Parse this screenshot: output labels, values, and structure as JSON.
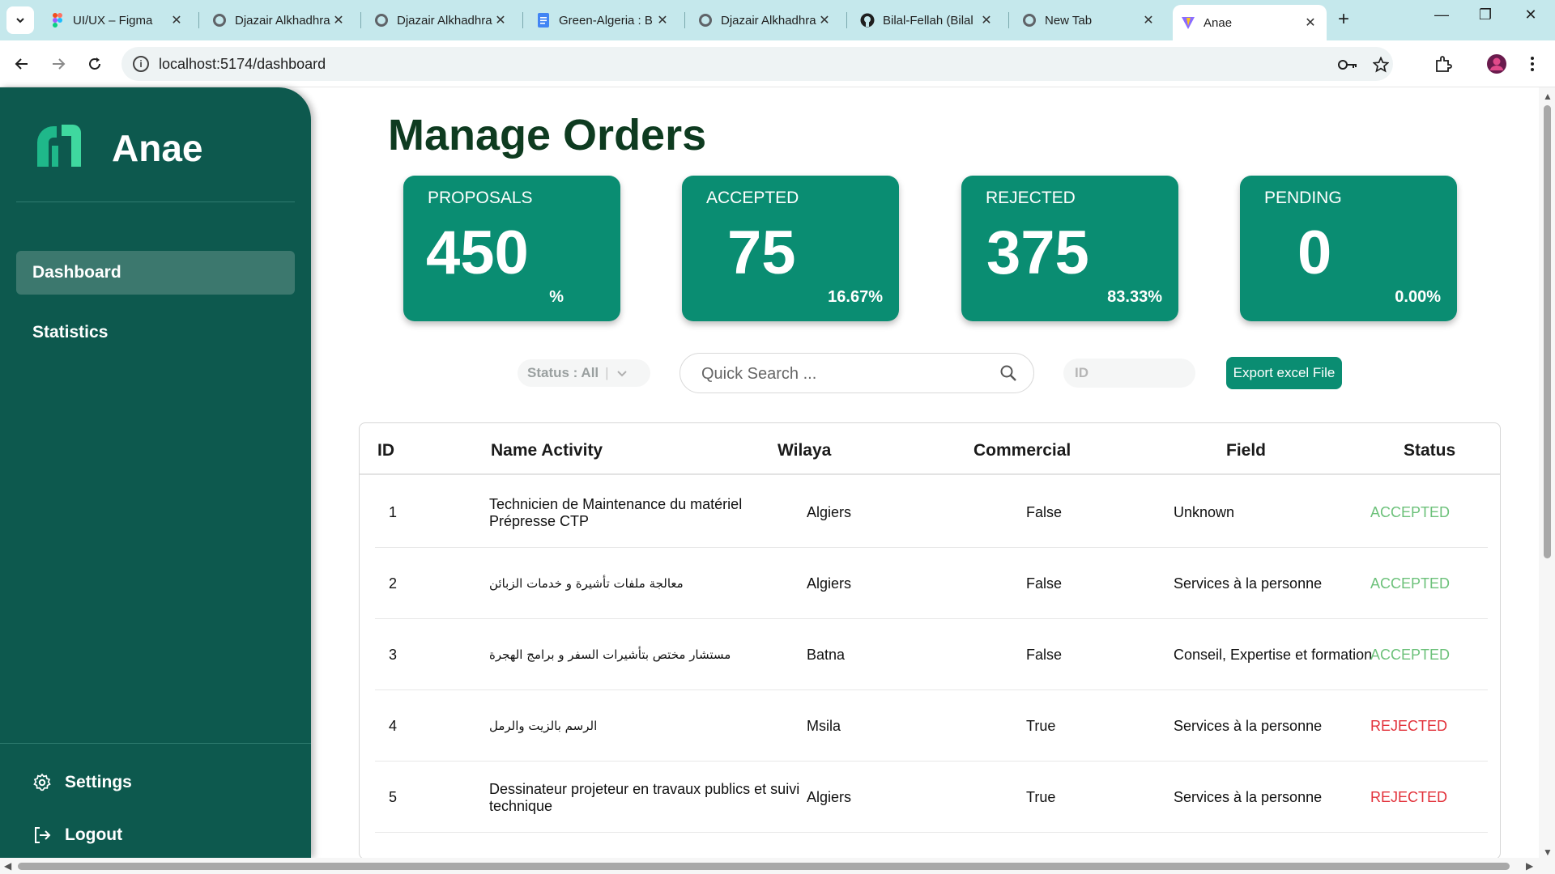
{
  "browser": {
    "tabs": [
      {
        "title": "UI/UX – Figma",
        "icon": "figma-icon"
      },
      {
        "title": "Djazair Alkhadhra",
        "icon": "globe-icon"
      },
      {
        "title": "Djazair Alkhadhra",
        "icon": "globe-icon"
      },
      {
        "title": "Green-Algeria : B",
        "icon": "docs-icon"
      },
      {
        "title": "Djazair Alkhadhra",
        "icon": "globe-icon"
      },
      {
        "title": "Bilal-Fellah (Bilal",
        "icon": "github-icon"
      },
      {
        "title": "New Tab",
        "icon": "globe-icon"
      },
      {
        "title": "Anae",
        "icon": "vite-icon",
        "active": true
      }
    ],
    "url": "localhost:5174/dashboard"
  },
  "sidebar": {
    "brand": "Anae",
    "nav": [
      {
        "label": "Dashboard",
        "active": true
      },
      {
        "label": "Statistics",
        "active": false
      }
    ],
    "settings_label": "Settings",
    "logout_label": "Logout"
  },
  "main": {
    "title": "Manage Orders",
    "cards": [
      {
        "label": "PROPOSALS",
        "value": "450",
        "percent": "%"
      },
      {
        "label": "ACCEPTED",
        "value": "75",
        "percent": "16.67%"
      },
      {
        "label": "REJECTED",
        "value": "375",
        "percent": "83.33%"
      },
      {
        "label": "PENDING",
        "value": "0",
        "percent": "0.00%"
      }
    ],
    "filters": {
      "status_label": "Status : All",
      "search_placeholder": "Quick Search ...",
      "id_placeholder": "ID",
      "export_label": "Export excel File"
    },
    "table": {
      "columns": [
        "ID",
        "Name Activity",
        "Wilaya",
        "Commercial",
        "Field",
        "Status"
      ],
      "rows": [
        {
          "id": "1",
          "activity": "Technicien de Maintenance du matériel Prépresse CTP",
          "wilaya": "Algiers",
          "commercial": "False",
          "field": "Unknown",
          "status": "ACCEPTED"
        },
        {
          "id": "2",
          "activity": "معالجة ملفات تأشيرة و خدمات الزبائن",
          "wilaya": "Algiers",
          "commercial": "False",
          "field": "Services à la personne",
          "status": "ACCEPTED"
        },
        {
          "id": "3",
          "activity": "مستشار مختص بتأشيرات السفر و برامج الهجرة",
          "wilaya": "Batna",
          "commercial": "False",
          "field": "Conseil, Expertise et formation",
          "status": "ACCEPTED"
        },
        {
          "id": "4",
          "activity": "الرسم بالزيت والرمل",
          "wilaya": "Msila",
          "commercial": "True",
          "field": "Services à la personne",
          "status": "REJECTED"
        },
        {
          "id": "5",
          "activity": "Dessinateur projeteur en travaux publics et suivi technique",
          "wilaya": "Algiers",
          "commercial": "True",
          "field": "Services à la personne",
          "status": "REJECTED"
        }
      ]
    }
  },
  "colors": {
    "sidebar_bg": "#0d594e",
    "card_bg": "#0a8d72",
    "title": "#0e3b20",
    "accepted": "#6cc17a",
    "rejected": "#e2313a"
  }
}
